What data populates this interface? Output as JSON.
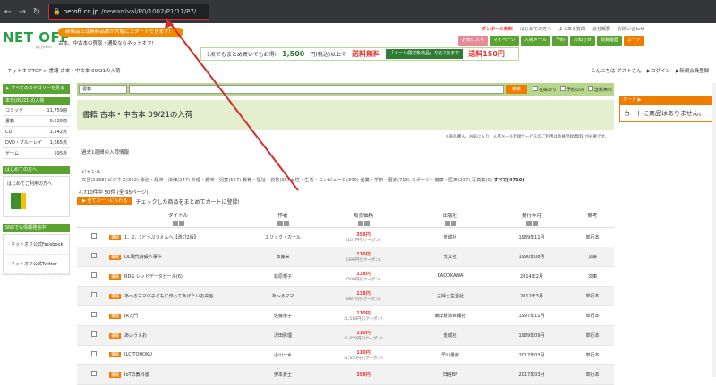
{
  "browser": {
    "url_host": "netoff.co.jp",
    "url_path": "/newarrival/P0/1002/P1/11/P7/"
  },
  "header": {
    "logo": "NET OFF",
    "logo_sub": "by Jikken",
    "pill": "新規品上は無料品数が大幅にスタートできます!",
    "tagline": "古本、中古本の買取・通販ならネットオフ!",
    "links": [
      "ダンボール無料",
      "はじめての方へ",
      "よくある質問",
      "会社概要",
      "お問い合わせ"
    ],
    "nav": [
      "お気に入り",
      "マイページ",
      "入荷メール",
      "予約",
      "お知らせ",
      "閲覧履歴",
      "カート"
    ]
  },
  "banner": {
    "lead": "1点でもまとめ買いでもお得!",
    "amount": "1,500",
    "suffix": "円(税込)以上で",
    "sale": "送料無料",
    "box": "「メール便対象商品」なら2点まで",
    "price": "送料150円"
  },
  "breadcrumb": "ネットオフTOP > 書籍 古本・中古本 09/21の入荷",
  "greeting": {
    "hello": "こんにちは ゲストさん",
    "login": "▶ログイン",
    "register": "▶新規会員登録"
  },
  "sidebar": {
    "all_categories": "▶ すべてのカテゴリーを見る",
    "today_head": "本日(09/21)の入荷",
    "today": [
      {
        "label": "コミック",
        "count": "11,759冊"
      },
      {
        "label": "書籍",
        "count": "9,529冊"
      },
      {
        "label": "CD",
        "count": "1,142点"
      },
      {
        "label": "DVD・ブルーレイ",
        "count": "1,665点"
      },
      {
        "label": "ゲーム",
        "count": "595点"
      }
    ],
    "first_head": "はじめての方へ",
    "first_link": "はじめてご利用の方へ",
    "sns_head": "SNSでも情報発信中!",
    "sns": [
      "ネットオフ公式Facebook",
      "ネットオフ公式Twitter"
    ]
  },
  "search": {
    "select": "書籍",
    "placeholder": "",
    "button": "検索",
    "checks": [
      "在庫あり",
      "予約のみ",
      "送料無料"
    ]
  },
  "page_title": "書籍 古本・中古本 09/21の入荷",
  "note": "※商品購入、お気に入り、入荷メール登録サービスのご利用は会員登録(無料)が必要です。",
  "weekly": "過去1週間の入荷情報",
  "genre_label": "ジャンル",
  "genres": "文芸(2188) ビジネス(362) 政治・経済・法律(247) 料理・趣味・児童(567) 教育・福祉・資格(96) 女性・生活・コンピュータ(300) 産業・学術・歴史(713) スポーツ・健康・医療(237) 写真集(0)",
  "genre_all": "すべて(4710)",
  "count": "4,710件中 50件 (全 95ページ)",
  "cart_button": "▶ 全てカートに入れる",
  "cart_note": "チェックした商品をまとめてカートに登録!",
  "columns": [
    "タイトル",
    "作者",
    "販売価格",
    "出版社",
    "発行年月",
    "備考"
  ],
  "rows": [
    {
      "badge": "書籍",
      "title": "1、2、3どうぶつえんへ【改訂2版】",
      "author": "エリック・カール",
      "price": "398円",
      "sub": "(101円引クーポン)",
      "pub": "偕成社",
      "date": "1989年11月",
      "note": "単行本"
    },
    {
      "badge": "書籍",
      "title": "OL現代詩殺人事件",
      "author": "斎藤栄",
      "price": "110円",
      "sub": "(396円引クーポン)",
      "pub": "光文社",
      "date": "1990年08月",
      "note": "文庫"
    },
    {
      "badge": "書籍",
      "title": "RDG レッドデータガール(6)",
      "author": "荻原規子",
      "price": "138円",
      "sub": "(500円引クーポン)",
      "pub": "KADOKAWA",
      "date": "2014年2月",
      "note": "文庫"
    },
    {
      "badge": "書籍",
      "title": "あ〜るママの子どもに作ってあげたいお弁当",
      "author": "あ〜るママ",
      "price": "138円",
      "sub": "(887円引クーポン)",
      "pub": "主婦と生活社",
      "date": "2012年3月",
      "note": "単行本"
    },
    {
      "badge": "書籍",
      "title": "IR入門",
      "author": "佐藤淑子",
      "price": "110円",
      "sub": "(1,518円引クーポン)",
      "pub": "東洋経済新報社",
      "date": "1997年11月",
      "note": "単行本"
    },
    {
      "badge": "書籍",
      "title": "あいうえお",
      "author": "沢田眞理",
      "price": "110円",
      "sub": "(1,650円引クーポン)",
      "pub": "偕成社",
      "date": "1989年09月",
      "note": "単行本"
    },
    {
      "badge": "書籍",
      "title": "ILC/TOHOKU",
      "author": "小川一水",
      "price": "110円",
      "sub": "(1,650円引クーポン)",
      "pub": "早川書房",
      "date": "2017年03月",
      "note": "単行本"
    },
    {
      "badge": "書籍",
      "title": "IoTの教科書",
      "author": "伊本貴士",
      "price": "398円",
      "sub": "",
      "pub": "日経BP",
      "date": "2017年03月",
      "note": "単行本"
    }
  ],
  "cart": {
    "head": "カート ▶",
    "body": "カートに商品はありません。"
  }
}
